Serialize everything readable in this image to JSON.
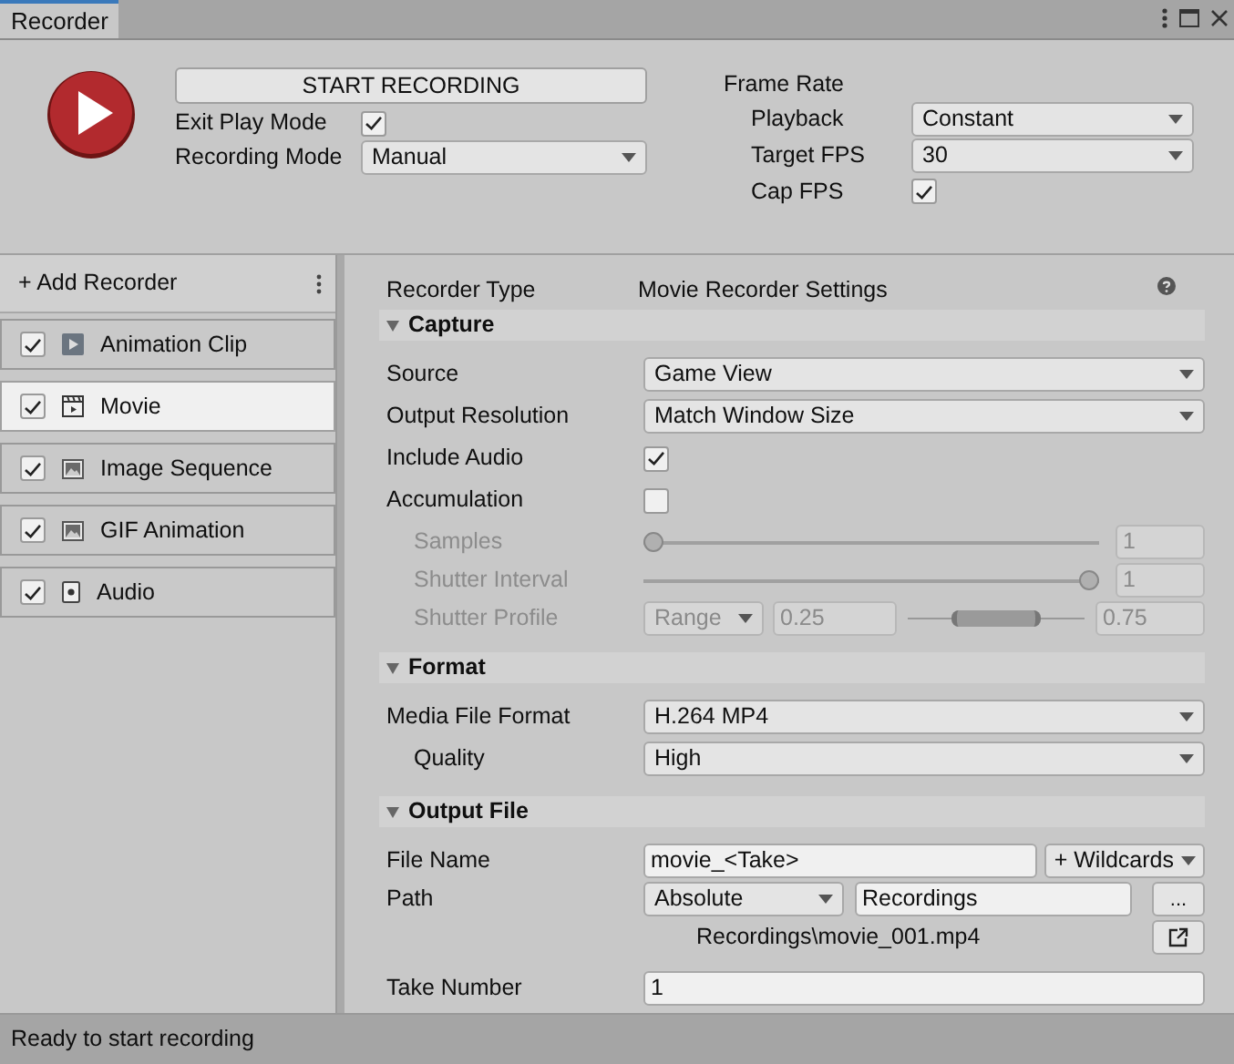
{
  "window": {
    "tab": "Recorder"
  },
  "controls": {
    "start_button": "START RECORDING",
    "exit_play_mode": {
      "label": "Exit Play Mode",
      "checked": true
    },
    "recording_mode": {
      "label": "Recording Mode",
      "value": "Manual"
    }
  },
  "frame_rate": {
    "title": "Frame Rate",
    "fields": [
      {
        "kind": "dropdown",
        "label": "Playback",
        "value": "Constant"
      },
      {
        "kind": "dropdown",
        "label": "Target FPS",
        "value": "30"
      },
      {
        "kind": "checkbox",
        "label": "Cap FPS",
        "checked": true
      }
    ]
  },
  "recorders": {
    "add_label": "+ Add Recorder",
    "items": [
      {
        "name": "Animation Clip",
        "enabled": true,
        "selected": false
      },
      {
        "name": "Movie",
        "enabled": true,
        "selected": true
      },
      {
        "name": "Image Sequence",
        "enabled": true,
        "selected": false
      },
      {
        "name": "GIF Animation",
        "enabled": true,
        "selected": false
      },
      {
        "name": "Audio",
        "enabled": true,
        "selected": false
      }
    ]
  },
  "settings": {
    "recorder_type": {
      "label": "Recorder Type",
      "value": "Movie Recorder Settings"
    },
    "sections": [
      {
        "title": "Capture",
        "expanded": true,
        "rows": [
          {
            "kind": "dropdown",
            "label": "Source",
            "value": "Game View",
            "indent": false,
            "disabled": false
          },
          {
            "kind": "dropdown",
            "label": "Output Resolution",
            "value": "Match Window Size",
            "indent": false,
            "disabled": false
          },
          {
            "kind": "checkbox",
            "label": "Include Audio",
            "checked": true,
            "indent": false,
            "disabled": false
          },
          {
            "kind": "checkbox",
            "label": "Accumulation",
            "checked": false,
            "indent": false,
            "disabled": false
          },
          {
            "kind": "slider",
            "label": "Samples",
            "level": 0,
            "value": "1",
            "indent": true,
            "disabled": true
          },
          {
            "kind": "slider",
            "label": "Shutter Interval",
            "level": 1,
            "value": "1",
            "indent": true,
            "disabled": true
          },
          {
            "kind": "range",
            "label": "Shutter Profile",
            "mode": "Range",
            "min": "0.25",
            "max": "0.75",
            "indent": true,
            "disabled": true
          }
        ]
      },
      {
        "title": "Format",
        "expanded": true,
        "rows": [
          {
            "kind": "dropdown",
            "label": "Media File Format",
            "value": "H.264 MP4",
            "indent": false,
            "disabled": false
          },
          {
            "kind": "dropdown",
            "label": "Quality",
            "value": "High",
            "indent": true,
            "disabled": false
          }
        ]
      },
      {
        "title": "Output File",
        "expanded": true,
        "rows": [
          {
            "kind": "text",
            "label": "File Name",
            "value": "movie_<Take>",
            "button": "+ Wildcards",
            "indent": false,
            "disabled": false
          },
          {
            "kind": "path",
            "label": "Path",
            "mode": "Absolute",
            "value": "Recordings",
            "browse": "...",
            "resolved": "Recordings\\movie_001.mp4",
            "indent": false,
            "disabled": false
          },
          {
            "kind": "input",
            "label": "Take Number",
            "value": "1",
            "indent": false,
            "disabled": false
          }
        ]
      }
    ]
  },
  "status_bar": "Ready to start recording"
}
